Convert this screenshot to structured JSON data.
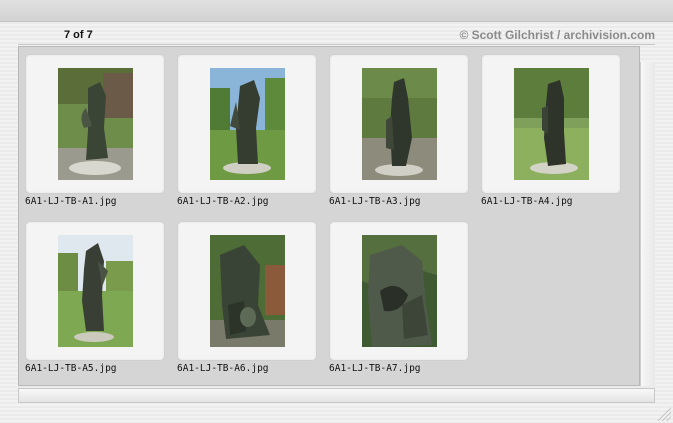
{
  "header": {
    "page_count": "7 of 7",
    "credit": "© Scott Gilchrist / archivision.com"
  },
  "thumbnails": [
    {
      "filename": "6A1-LJ-TB-A1.jpg",
      "icon": "sculpture-photo",
      "bg": "#6f8d4a"
    },
    {
      "filename": "6A1-LJ-TB-A2.jpg",
      "icon": "sculpture-photo",
      "bg": "#8ab5d8"
    },
    {
      "filename": "6A1-LJ-TB-A3.jpg",
      "icon": "sculpture-photo",
      "bg": "#5f7a3e"
    },
    {
      "filename": "6A1-LJ-TB-A4.jpg",
      "icon": "sculpture-photo",
      "bg": "#7ea05a"
    },
    {
      "filename": "6A1-LJ-TB-A5.jpg",
      "icon": "sculpture-photo",
      "bg": "#dfe8ee"
    },
    {
      "filename": "6A1-LJ-TB-A6.jpg",
      "icon": "sculpture-photo",
      "bg": "#4e6c35"
    },
    {
      "filename": "6A1-LJ-TB-A7.jpg",
      "icon": "sculpture-photo",
      "bg": "#3f5a33"
    }
  ]
}
